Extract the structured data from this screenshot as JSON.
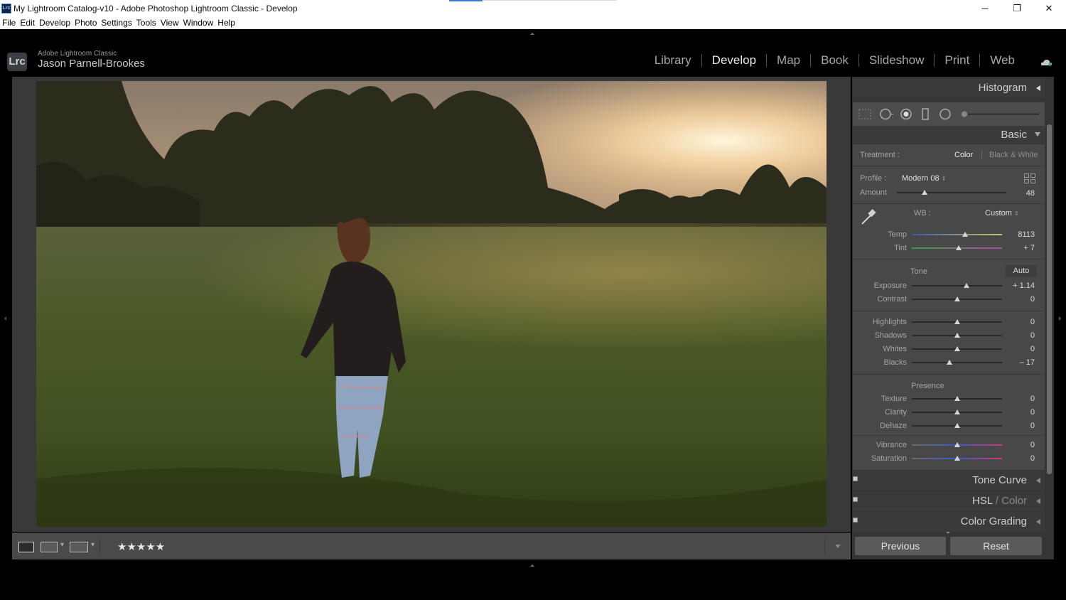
{
  "window": {
    "title": "My Lightroom Catalog-v10 - Adobe Photoshop Lightroom Classic - Develop",
    "app_icon_text": "Lrc",
    "minimize": "─",
    "maximize": "❐",
    "close": "✕"
  },
  "menu": [
    "File",
    "Edit",
    "Develop",
    "Photo",
    "Settings",
    "Tools",
    "View",
    "Window",
    "Help"
  ],
  "identity": {
    "logo": "Lrc",
    "product": "Adobe Lightroom Classic",
    "user": "Jason Parnell-Brookes"
  },
  "modules": [
    "Library",
    "Develop",
    "Map",
    "Book",
    "Slideshow",
    "Print",
    "Web"
  ],
  "active_module": "Develop",
  "toolbar": {
    "rating": "★★★★★",
    "view_modes": [
      "loupe-view-icon",
      "before-after-icon",
      "before-after-split-icon"
    ]
  },
  "panels": {
    "histogram": "Histogram",
    "basic": "Basic",
    "tone_curve": "Tone Curve",
    "hsl": "HSL",
    "hsl_slash": "/",
    "color": "Color",
    "color_grading": "Color Grading"
  },
  "basic": {
    "treatment_label": "Treatment :",
    "treatment_color": "Color",
    "treatment_bw": "Black & White",
    "profile_label": "Profile :",
    "profile_value": "Modern 08",
    "amount_label": "Amount",
    "amount_value": "48",
    "wb_label": "WB :",
    "wb_value": "Custom",
    "tone_label": "Tone",
    "auto_label": "Auto",
    "presence_label": "Presence",
    "sliders": [
      {
        "label": "Temp",
        "value": "8113",
        "fraction": 0.59
      },
      {
        "label": "Tint",
        "value": "+ 7",
        "fraction": 0.52
      },
      {
        "label": "Exposure",
        "value": "+ 1.14",
        "fraction": 0.61
      },
      {
        "label": "Contrast",
        "value": "0",
        "fraction": 0.5
      },
      {
        "label": "Highlights",
        "value": "0",
        "fraction": 0.5
      },
      {
        "label": "Shadows",
        "value": "0",
        "fraction": 0.5
      },
      {
        "label": "Whites",
        "value": "0",
        "fraction": 0.5
      },
      {
        "label": "Blacks",
        "value": "– 17",
        "fraction": 0.42
      },
      {
        "label": "Texture",
        "value": "0",
        "fraction": 0.5
      },
      {
        "label": "Clarity",
        "value": "0",
        "fraction": 0.5
      },
      {
        "label": "Dehaze",
        "value": "0",
        "fraction": 0.5
      },
      {
        "label": "Vibrance",
        "value": "0",
        "fraction": 0.5
      },
      {
        "label": "Saturation",
        "value": "0",
        "fraction": 0.5
      }
    ],
    "amount_fraction": 0.25
  },
  "buttons": {
    "previous": "Previous",
    "reset": "Reset"
  }
}
